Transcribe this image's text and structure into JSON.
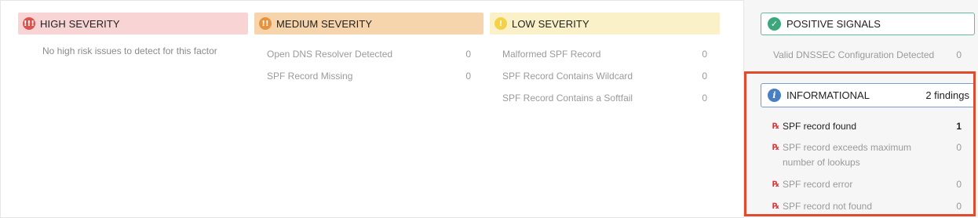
{
  "high": {
    "title": "HIGH SEVERITY",
    "icon": "triple-exclamation-icon",
    "empty_message": "No high risk issues to detect for this factor"
  },
  "medium": {
    "title": "MEDIUM SEVERITY",
    "icon": "double-exclamation-icon",
    "items": [
      {
        "label": "Open DNS Resolver Detected",
        "count": "0"
      },
      {
        "label": "SPF Record Missing",
        "count": "0"
      }
    ]
  },
  "low": {
    "title": "LOW SEVERITY",
    "icon": "exclamation-icon",
    "items": [
      {
        "label": "Malformed SPF Record",
        "count": "0"
      },
      {
        "label": "SPF Record Contains Wildcard",
        "count": "0"
      },
      {
        "label": "SPF Record Contains a Softfail",
        "count": "0"
      }
    ]
  },
  "positive": {
    "title": "POSITIVE SIGNALS",
    "icon": "check-icon",
    "items": [
      {
        "label": "Valid DNSSEC Configuration Detected",
        "count": "0"
      }
    ]
  },
  "informational": {
    "title": "INFORMATIONAL",
    "icon": "info-icon",
    "count_label": "2 findings",
    "items": [
      {
        "label": "SPF record found",
        "count": "1"
      },
      {
        "label": "SPF record exceeds maximum number of lookups",
        "count": "0"
      },
      {
        "label": "SPF record error",
        "count": "0"
      },
      {
        "label": "SPF record not found",
        "count": "0"
      }
    ]
  },
  "colors": {
    "high": "#d9534f",
    "medium": "#e8923d",
    "low": "#f3d24a",
    "positive": "#3aa87a",
    "informational": "#4a7ec2",
    "highlight": "#e04a2f"
  }
}
